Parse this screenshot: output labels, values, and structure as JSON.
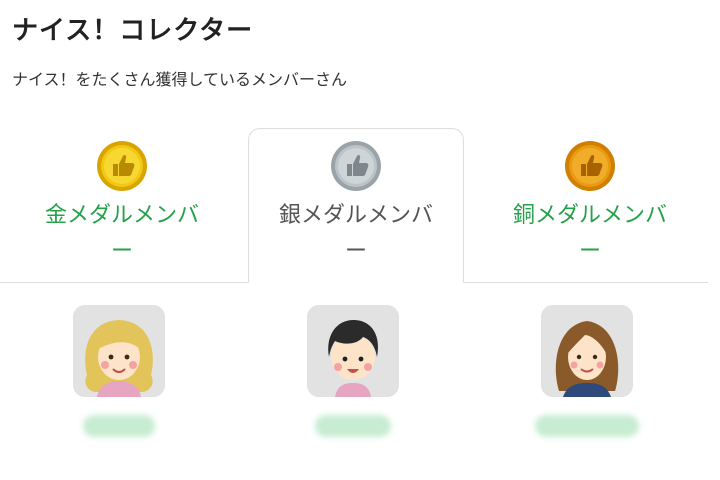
{
  "page": {
    "title": "ナイス！コレクター",
    "subtitle": "ナイス！をたくさん獲得しているメンバーさん"
  },
  "tabs": [
    {
      "label": "金メダルメンバー",
      "icon": "gold-thumbs-up-medal-icon",
      "color": "#e8b800",
      "active": false
    },
    {
      "label": "銀メダルメンバー",
      "icon": "silver-thumbs-up-medal-icon",
      "color": "#a8b2b6",
      "active": true
    },
    {
      "label": "銅メダルメンバー",
      "icon": "bronze-thumbs-up-medal-icon",
      "color": "#e99a10",
      "active": false
    }
  ],
  "members": [
    {
      "avatar": "blonde-woman-avatar",
      "name_blurred": true
    },
    {
      "avatar": "black-haired-boy-avatar",
      "name_blurred": true
    },
    {
      "avatar": "brown-haired-woman-avatar",
      "name_blurred": true
    }
  ],
  "colors": {
    "accent_green": "#25a149",
    "tab_border": "#dddddd",
    "avatar_bg": "#e2e2e2"
  }
}
